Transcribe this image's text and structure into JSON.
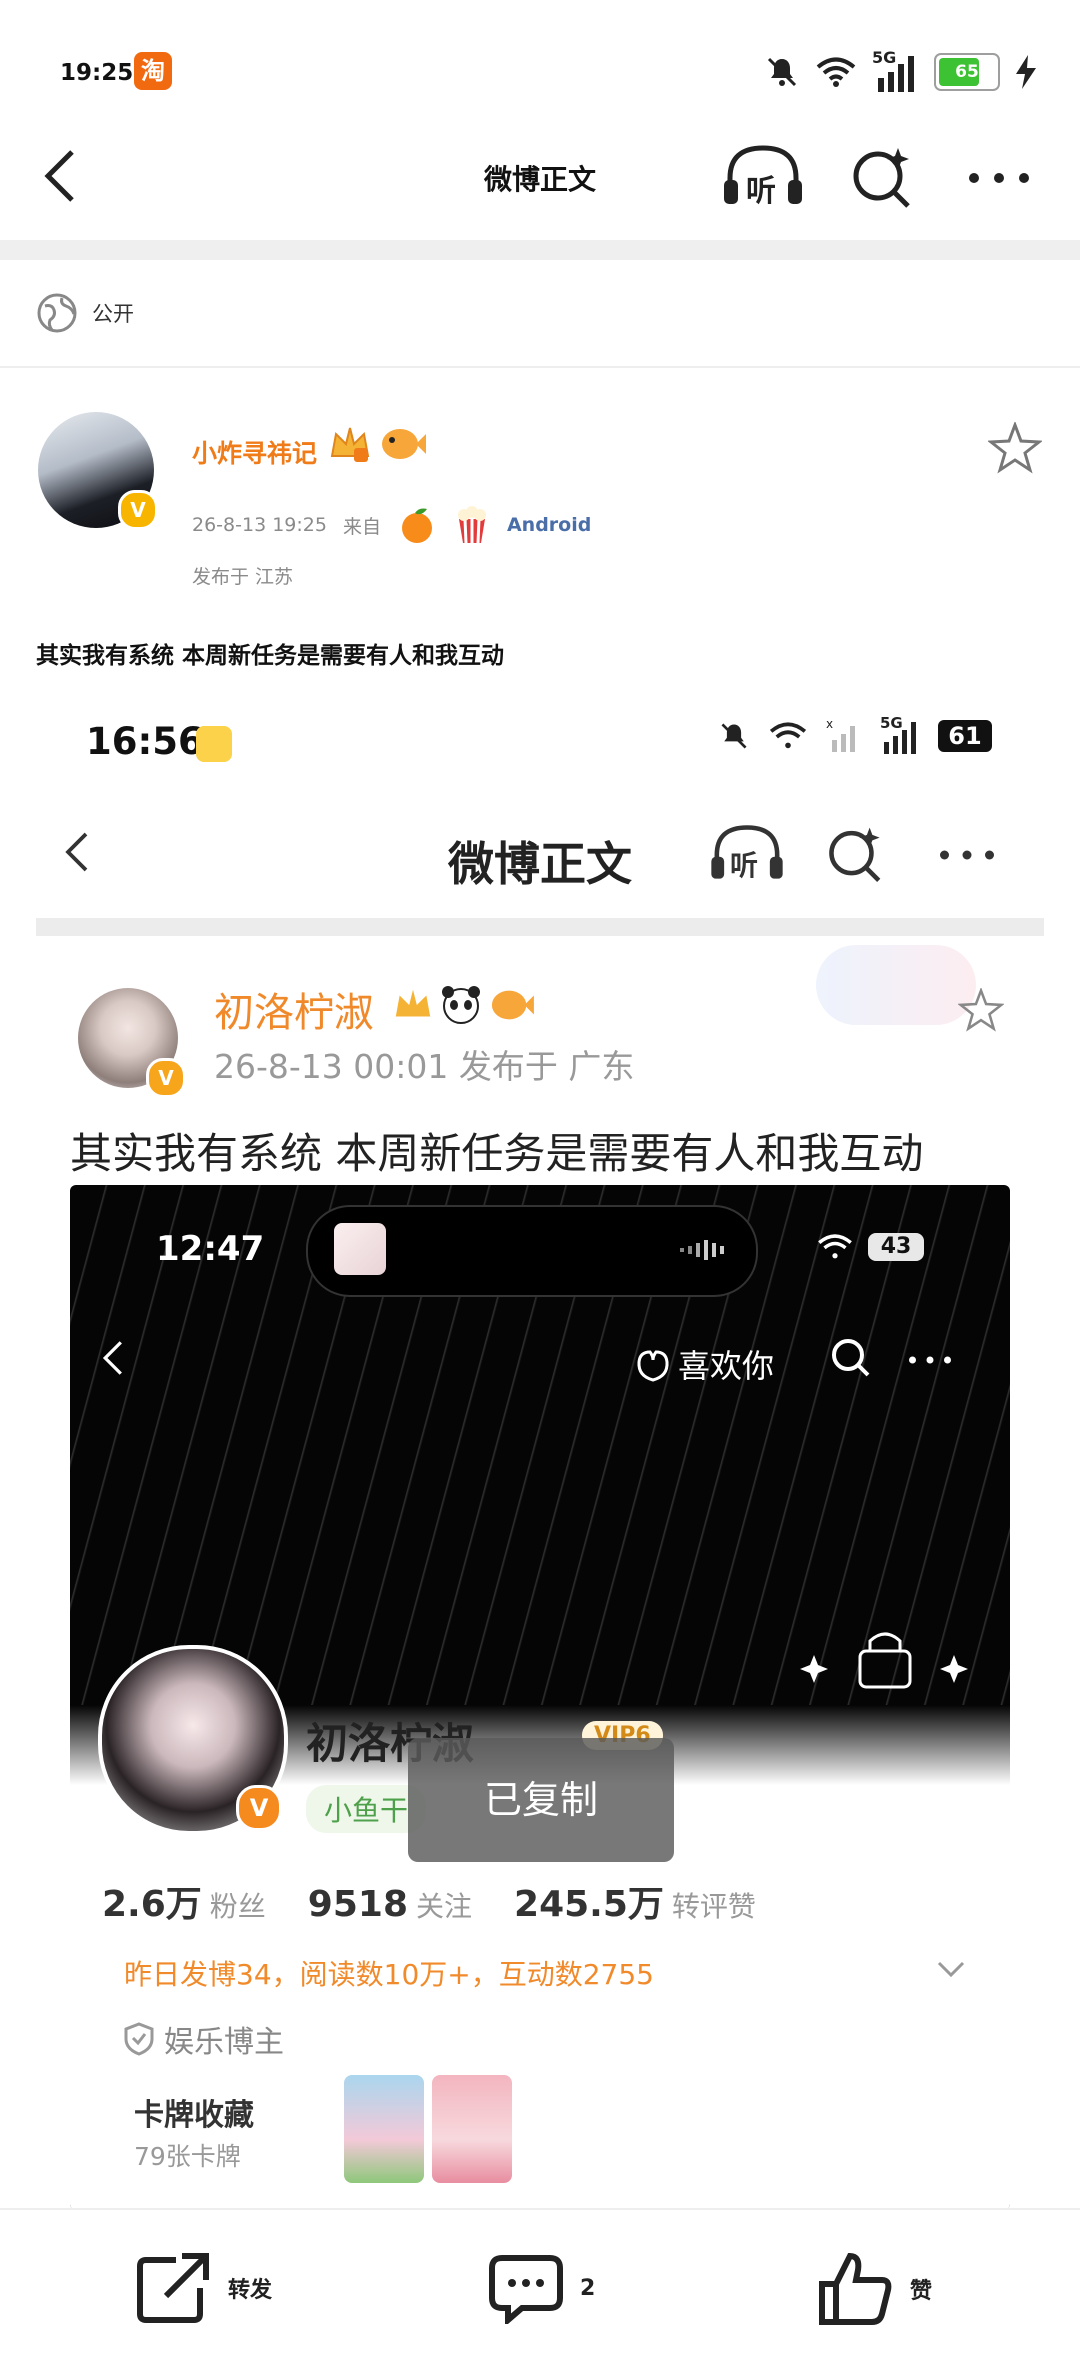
{
  "status_bar": {
    "time": "19:25",
    "taobao_icon_label": "淘",
    "network": "5G",
    "battery": "65"
  },
  "nav": {
    "title": "微博正文",
    "listen_icon_label": "听"
  },
  "post": {
    "visibility": "公开",
    "author": "小炸寻祎记",
    "verified_badge": "V",
    "timestamp": "26-8-13 19:25",
    "source_prefix": "来自",
    "source_platform": "Android",
    "location": "发布于 江苏",
    "text": "其实我有系统 本周新任务是需要有人和我互动"
  },
  "embedded": {
    "status_time": "16:56",
    "network": "5G",
    "battery": "61",
    "nav_title": "微博正文",
    "listen_icon_label": "听",
    "author": "初洛柠淑",
    "verified_badge": "V",
    "meta": "26-8-13 00:01  发布于 广东",
    "text": "其实我有系统 本周新任务是需要有人和我互动",
    "inner": {
      "status_time": "12:47",
      "battery": "43",
      "like_label": "喜欢你",
      "profile_name": "初洛柠淑",
      "verified_badge": "V",
      "vip_label": "VIP6",
      "tag": "小鱼干",
      "stats": [
        {
          "num": "2.6万",
          "label": "粉丝"
        },
        {
          "num": "9518",
          "label": "关注"
        },
        {
          "num": "245.5万",
          "label": "转评赞"
        }
      ],
      "summary": "昨日发博34，阅读数10万+，互动数2755",
      "entertainment": "娱乐博主",
      "cards_title": "卡牌收藏",
      "cards_count": "79张卡牌",
      "toast": "已复制"
    }
  },
  "bottom_bar": {
    "repost": "转发",
    "comment_count": "2",
    "like": "赞"
  },
  "colors": {
    "accent_orange": "#f07c19",
    "link_blue": "#4a6ea8"
  }
}
